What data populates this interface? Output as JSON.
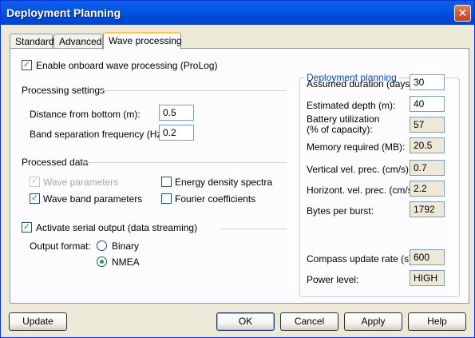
{
  "window": {
    "title": "Deployment Planning",
    "close_glyph": "✕"
  },
  "tabs": [
    {
      "label": "Standard"
    },
    {
      "label": "Advanced"
    },
    {
      "label": "Wave processing"
    }
  ],
  "wave": {
    "enable_label": "Enable onboard wave processing (ProLog)",
    "enable_checked": true,
    "processing_settings_title": "Processing settings",
    "distance_label": "Distance from bottom (m):",
    "distance_value": "0.5",
    "band_sep_label": "Band separation frequency (Hz):",
    "band_sep_value": "0.2",
    "processed_data_title": "Processed data",
    "wave_params_label": "Wave parameters",
    "wave_band_label": "Wave band parameters",
    "energy_label": "Energy density spectra",
    "fourier_label": "Fourier coefficients",
    "serial_label": "Activate serial output (data streaming)",
    "output_format_label": "Output format:",
    "binary_label": "Binary",
    "nmea_label": "NMEA"
  },
  "planning": {
    "title": "Deployment planning",
    "assumed_duration_label": "Assumed duration (days):",
    "assumed_duration_value": "30",
    "estimated_depth_label": "Estimated depth (m):",
    "estimated_depth_value": "40",
    "battery_label_1": "Battery utilization",
    "battery_label_2": "(% of capacity):",
    "battery_value": "57",
    "memory_label": "Memory required (MB):",
    "memory_value": "20.5",
    "vertical_label": "Vertical vel. prec. (cm/s):",
    "vertical_value": "0.7",
    "horizontal_label": "Horizont. vel. prec. (cm/s):",
    "horizontal_value": "2.2",
    "bytes_label": "Bytes per burst:",
    "bytes_value": "1792",
    "compass_label": "Compass update rate (s):",
    "compass_value": "600",
    "power_label": "Power level:",
    "power_value": "HIGH"
  },
  "buttons": {
    "update": "Update",
    "ok": "OK",
    "cancel": "Cancel",
    "apply": "Apply",
    "help": "Help"
  }
}
